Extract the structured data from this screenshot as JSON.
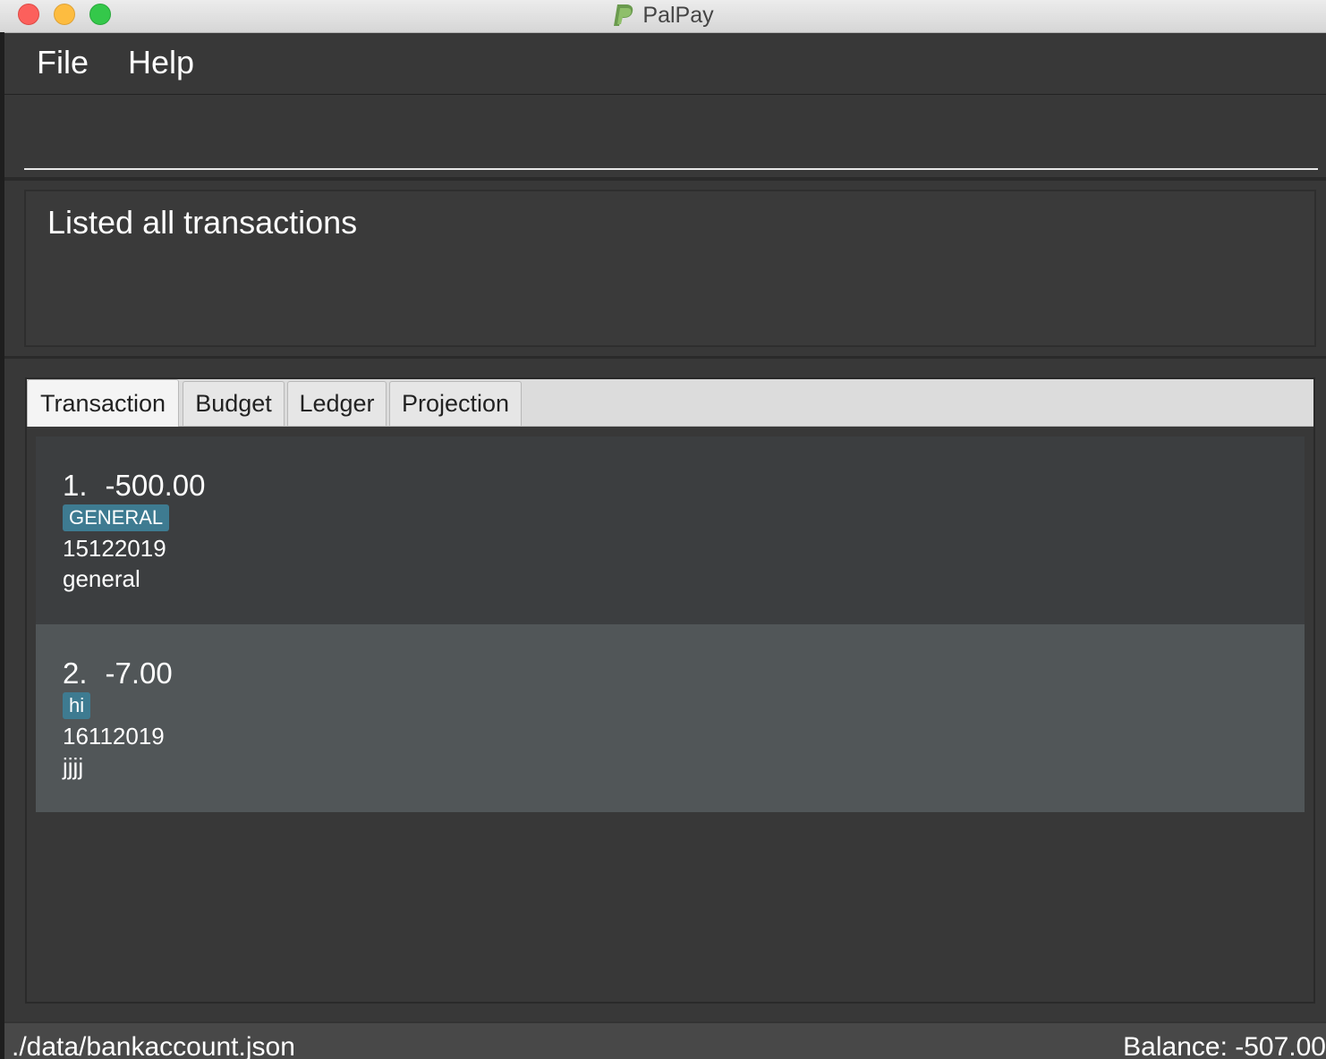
{
  "window": {
    "title": "PalPay",
    "logo_icon": "paypal-logo-icon"
  },
  "menu": {
    "items": [
      {
        "label": "File"
      },
      {
        "label": "Help"
      }
    ]
  },
  "command_box": {
    "value": "",
    "placeholder": ""
  },
  "result_display": {
    "text": "Listed all transactions"
  },
  "tabs": [
    {
      "label": "Transaction",
      "selected": true
    },
    {
      "label": "Budget",
      "selected": false
    },
    {
      "label": "Ledger",
      "selected": false
    },
    {
      "label": "Projection",
      "selected": false
    }
  ],
  "transactions": [
    {
      "index": "1.",
      "amount": "-500.00",
      "tag": "GENERAL",
      "date": "15122019",
      "description": "general"
    },
    {
      "index": "2.",
      "amount": "-7.00",
      "tag": "hi",
      "date": "16112019",
      "description": "jjjj"
    }
  ],
  "status_bar": {
    "path": "./data/bankaccount.json",
    "balance": "Balance: -507.00"
  },
  "colors": {
    "tag_background": "#3e7b91",
    "odd_row": "#3c3e40",
    "even_row": "#515658",
    "panel_background": "#383838"
  }
}
